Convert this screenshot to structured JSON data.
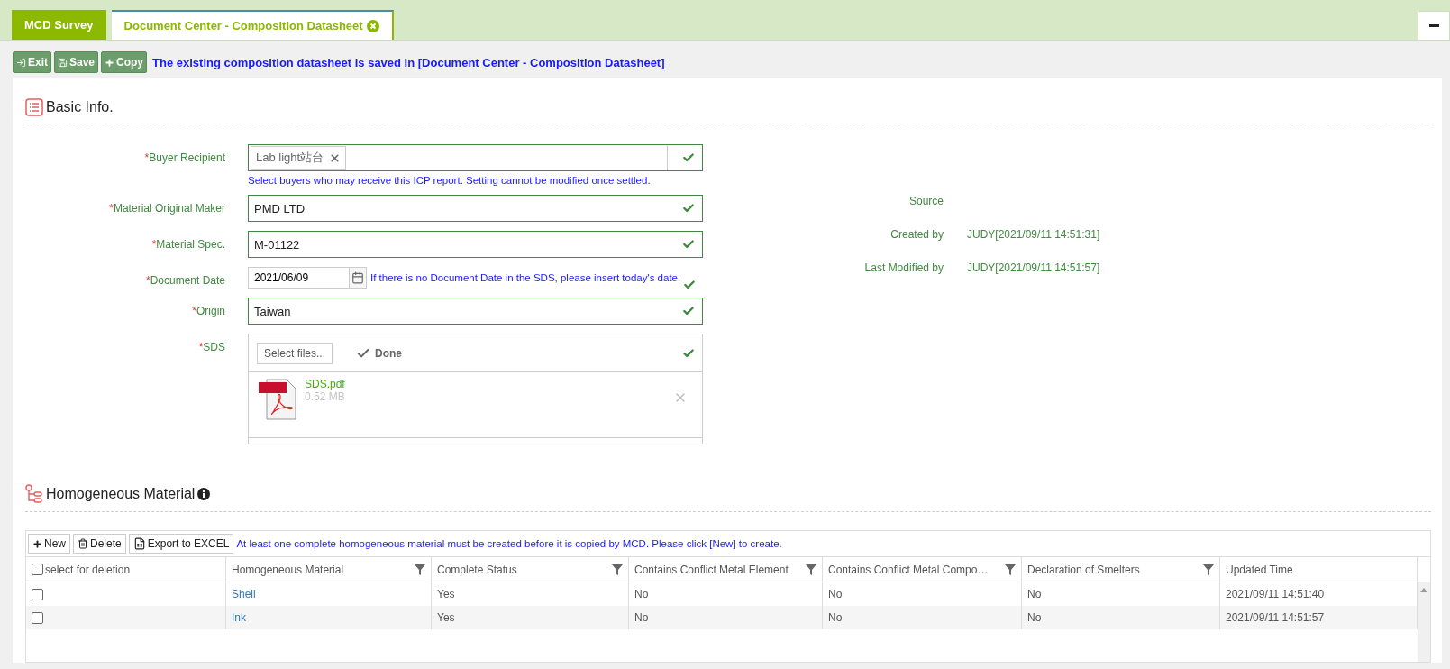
{
  "tabs": [
    {
      "label": "MCD Survey",
      "selected": false,
      "closable": false
    },
    {
      "label": "Document Center - Composition Datasheet",
      "selected": true,
      "closable": true
    }
  ],
  "toolbar": {
    "buttons": [
      {
        "label": "Exit",
        "kind": "exit"
      },
      {
        "label": "Save",
        "kind": "save"
      },
      {
        "label": "Copy",
        "kind": "copy"
      }
    ],
    "message": "The existing composition datasheet is saved in [Document Center - Composition Datasheet]"
  },
  "basic_info": {
    "title": "Basic Info.",
    "fields": [
      {
        "label": "Buyer Recipient",
        "marker": "*",
        "kind": "tags",
        "tags": [
          "Lab light站台"
        ],
        "valid": true,
        "hint": "Select buyers who may receive this ICP report. Setting cannot be modified once settled."
      },
      {
        "label": "Material Original Maker",
        "marker": "*",
        "kind": "text",
        "value": "PMD LTD",
        "valid": true
      },
      {
        "label": "Material Spec.",
        "marker": "*",
        "kind": "text",
        "value": "M-01122",
        "valid": true
      },
      {
        "label": "Document Date",
        "marker": "*",
        "kind": "date",
        "value": "2021/06/09",
        "valid": true,
        "hint": "If there is no Document Date in the SDS, please insert today's date."
      },
      {
        "label": "Origin",
        "marker": "*",
        "kind": "text",
        "value": "Taiwan",
        "valid": true
      },
      {
        "label": "SDS",
        "marker": "*",
        "kind": "upload",
        "valid": true,
        "select_button": "Select files...",
        "status": "Done",
        "files": [
          {
            "name": "SDS.pdf",
            "size": "0.52 MB"
          }
        ]
      }
    ],
    "info": [
      {
        "label": "Source"
      },
      {
        "label": "Created by",
        "value": "JUDY[2021/09/11 14:51:31]"
      },
      {
        "label": "Last Modified by",
        "value": "JUDY[2021/09/11 14:51:57]"
      }
    ]
  },
  "homogeneous": {
    "title": "Homogeneous Material",
    "toolbar": [
      {
        "label": "New",
        "kind": "new"
      },
      {
        "label": "Delete",
        "kind": "delete"
      },
      {
        "label": "Export to EXCEL",
        "kind": "excel"
      }
    ],
    "message": "At least one complete homogeneous material must be created before it is copied by MCD. Please click [New] to create.",
    "columns": [
      {
        "label": "select for deletion",
        "kind": "select",
        "checked": false
      },
      {
        "label": "Homogeneous Material",
        "filter": true
      },
      {
        "label": "Complete Status",
        "filter": true
      },
      {
        "label": "Contains Conflict Metal Element",
        "filter": true
      },
      {
        "label": "Contains Conflict Metal Compo…",
        "filter": true
      },
      {
        "label": "Declaration of Smelters",
        "filter": true
      },
      {
        "label": "Updated Time",
        "filter": false
      }
    ],
    "rows": [
      {
        "checked": false,
        "name": "Shell",
        "complete": "Yes",
        "element": "No",
        "compound": "No",
        "smelters": "No",
        "updated": "2021/09/11 14:51:40"
      },
      {
        "checked": false,
        "name": "Ink",
        "complete": "Yes",
        "element": "No",
        "compound": "No",
        "smelters": "No",
        "updated": "2021/09/11 14:51:57"
      }
    ]
  }
}
